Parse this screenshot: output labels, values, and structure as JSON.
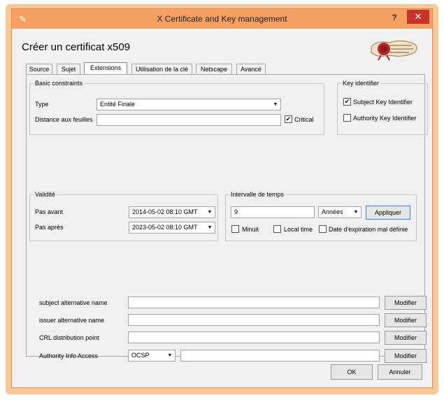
{
  "window": {
    "title": "X Certificate and Key management",
    "help_label": "?",
    "close_label": "✕"
  },
  "page_title": "Créer un certificat x509",
  "tabs": [
    "Source",
    "Sujet",
    "Extensions",
    "Utilisation de la clé",
    "Netscape",
    "Avancé"
  ],
  "active_tab": "Extensions",
  "basic_constraints": {
    "title": "Basic constraints",
    "type_label": "Type",
    "type_value": "Entité Finale",
    "distance_label": "Distance aux feuilles",
    "distance_value": "",
    "critical_label": "Critical",
    "critical_checked": true
  },
  "key_identifier": {
    "title": "Key identifier",
    "subject_label": "Subject Key Identifier",
    "subject_checked": true,
    "authority_label": "Authority Key Identifier",
    "authority_checked": false
  },
  "validity": {
    "title": "Validité",
    "not_before_label": "Pas avant",
    "not_before_value": "2014-05-02 08:10 GMT",
    "not_after_label": "Pas après",
    "not_after_value": "2023-05-02 08:10 GMT"
  },
  "time_interval": {
    "title": "Intervalle de temps",
    "value": "9",
    "unit": "Années",
    "apply_label": "Appliquer",
    "midnight_label": "Minuit",
    "local_time_label": "Local time",
    "bad_expiry_label": "Date d'expiration mal définie"
  },
  "extensions": {
    "san_label": "subject alternative name",
    "ian_label": "issuer alternative name",
    "crl_label": "CRL distribution point",
    "aia_label": "Authority Info Access",
    "aia_type": "OCSP",
    "modify_label": "Modifier"
  },
  "footer": {
    "ok_label": "OK",
    "cancel_label": "Annuler"
  },
  "icons": {
    "arrow": "▼",
    "check": "✔",
    "app": "✎"
  }
}
